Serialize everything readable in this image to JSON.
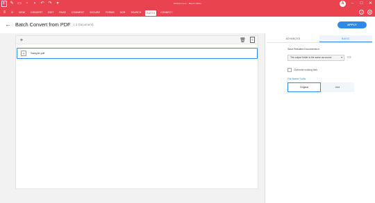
{
  "titlebar": {
    "app_title": "PDFelement - Batch PDFs",
    "logo_label": "E",
    "quick_icons": [
      "edit-icon",
      "open-icon",
      "save-icon",
      "print-icon",
      "undo-icon",
      "redo-icon",
      "dropdown-icon"
    ],
    "avatar_letter": "A"
  },
  "menubar": {
    "items": [
      "VIEW",
      "CONVERT",
      "EDIT",
      "PAGE",
      "COMMENT",
      "SECURE",
      "FORMS",
      "OCR",
      "SEARCH",
      "BATCH",
      "CONNECT"
    ],
    "active_item": "BATCH"
  },
  "header": {
    "title": "Batch Convert from PDF",
    "doc_count": "( 1 Document)",
    "primary_button": "APPLY"
  },
  "file_list": {
    "files": [
      {
        "name": "Sample.pdf"
      }
    ]
  },
  "settings": {
    "tabs": [
      "ADVANCED",
      "BASIC"
    ],
    "active_tab": "BASIC",
    "save_label": "Save Resulted Documents in",
    "folder_option": "The output folder is the same as source",
    "overwrite_label": "Overwrite existing files",
    "page_size_label": "File Name Suffix",
    "segment_options": [
      "Original",
      "Add"
    ],
    "active_segment": "Original"
  },
  "colors": {
    "brand": "#e8434f",
    "accent": "#2e8ae6"
  }
}
